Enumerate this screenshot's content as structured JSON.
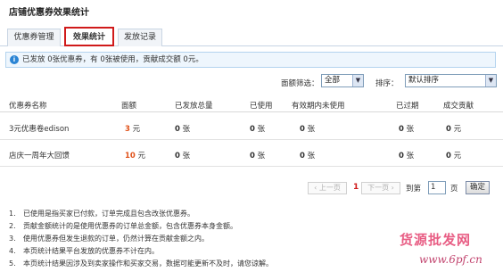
{
  "page_title": "店铺优惠券效果统计",
  "tabs": [
    {
      "label": "优惠券管理"
    },
    {
      "label": "效果统计"
    },
    {
      "label": "发放记录"
    }
  ],
  "info": {
    "icon": "info-icon",
    "text": "已发放 0张优惠券，有 0张被使用，贡献成交额 0元。"
  },
  "filters": {
    "denomination_label": "面额筛选：",
    "denomination_value": "全部",
    "sort_label": "排序：",
    "sort_value": "默认排序"
  },
  "table": {
    "headers": [
      "优惠券名称",
      "面额",
      "已发放总量",
      "已使用",
      "有效期内未使用",
      "已过期",
      "成交贡献"
    ],
    "rows": [
      {
        "name": "3元优惠卷edison",
        "amount": "3",
        "amount_unit": "元",
        "issued": "0",
        "issued_unit": "张",
        "used": "0",
        "used_unit": "张",
        "unused": "0",
        "unused_unit": "张",
        "expired": "0",
        "expired_unit": "张",
        "contribution": "0",
        "contribution_unit": "元"
      },
      {
        "name": "店庆一周年大回馈",
        "amount": "10",
        "amount_unit": "元",
        "issued": "0",
        "issued_unit": "张",
        "used": "0",
        "used_unit": "张",
        "unused": "0",
        "unused_unit": "张",
        "expired": "0",
        "expired_unit": "张",
        "contribution": "0",
        "contribution_unit": "元"
      }
    ]
  },
  "pagination": {
    "prev_label": "上一页",
    "current_page": "1",
    "next_label": "下一页",
    "goto_label": "到第",
    "page_input_value": "1",
    "page_word": "页",
    "confirm_label": "确定"
  },
  "notes": [
    {
      "num": "1.",
      "text": "已使用是指买家已付款，订单完成且包含改张优惠券。"
    },
    {
      "num": "2.",
      "text": "贡献金额统计的是使用优惠券的订单总金额，包含优惠券本身金额。"
    },
    {
      "num": "3.",
      "text": "使用优惠券但发生退款的订单，仍然计算在贡献金额之内。"
    },
    {
      "num": "4.",
      "text": "本页统计结果平台发放的优惠券不计在内。"
    },
    {
      "num": "5.",
      "text": "本页统计结果因涉及到卖家操作和买家交易，数据可能更新不及时，请您谅解。"
    }
  ],
  "watermark": {
    "text": "货源批发网",
    "url": "www.6pf.cn"
  },
  "colors": {
    "accent_red": "#d01a1a",
    "amount_orange": "#e0521a",
    "info_bg": "#eef6fd",
    "info_border": "#b3d3ef",
    "watermark": "#e85d84"
  }
}
